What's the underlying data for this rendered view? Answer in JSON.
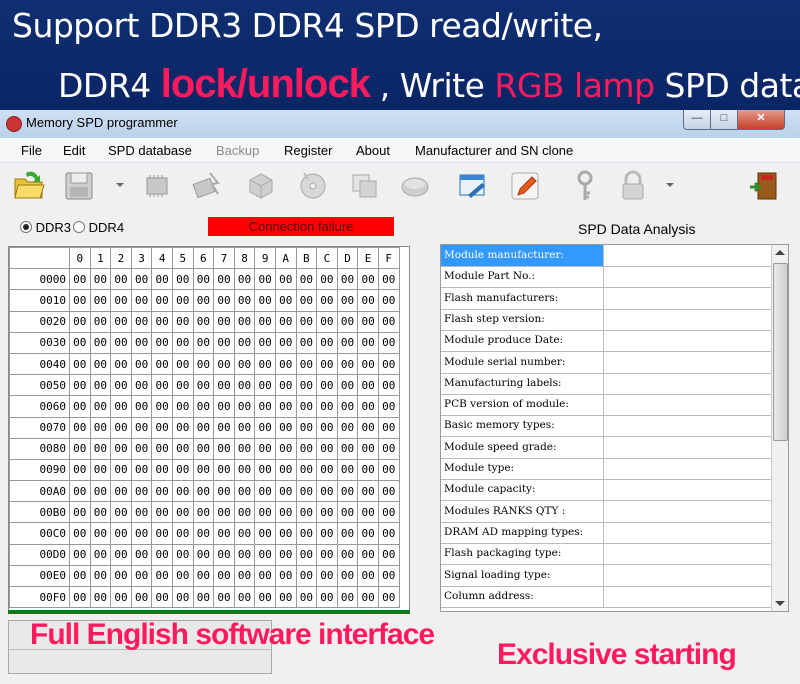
{
  "banner": {
    "line1": "Support DDR3 DDR4 SPD read/write,",
    "line2_prefix": "DDR4 ",
    "line2_highlight": "lock/unlock",
    "line2_mid": " , Write ",
    "line2_highlight2": "RGB lamp",
    "line2_suffix": " SPD data",
    "highlight_color": "#ff1a5e"
  },
  "window": {
    "title": "Memory SPD programmer",
    "min_glyph": "—",
    "max_glyph": "□",
    "close_glyph": "✕"
  },
  "menu": [
    "File",
    "Edit",
    "SPD database",
    "Backup",
    "Register",
    "About",
    "Manufacturer and SN clone"
  ],
  "menu_disabled": "Backup",
  "toolbar": {
    "icons": [
      "open-folder-icon",
      "save-icon",
      "chip-icon",
      "chip-flash-icon",
      "cube-icon",
      "disc-icon",
      "copy-icon",
      "oval-icon",
      "edit-window-icon",
      "pencil-icon",
      "key-icon",
      "padlock-icon",
      "exit-door-icon"
    ]
  },
  "radio": {
    "ddr3": "DDR3",
    "ddr4": "DDR4",
    "selected": "DDR3"
  },
  "status": {
    "connection": "Connection failure",
    "color": "#ff0000"
  },
  "analysis_title": "SPD Data Analysis",
  "hex": {
    "columns": [
      "0",
      "1",
      "2",
      "3",
      "4",
      "5",
      "6",
      "7",
      "8",
      "9",
      "A",
      "B",
      "C",
      "D",
      "E",
      "F"
    ],
    "rows": [
      "0000",
      "0010",
      "0020",
      "0030",
      "0040",
      "0050",
      "0060",
      "0070",
      "0080",
      "0090",
      "00A0",
      "00B0",
      "00C0",
      "00D0",
      "00E0",
      "00F0"
    ],
    "fill_value": "00"
  },
  "analysis": [
    "Module manufacturer:",
    "Module Part No.:",
    "Flash manufacturers:",
    "Flash step version:",
    "Module produce Date:",
    "Module serial number:",
    "Manufacturing labels:",
    "PCB version of module:",
    "Basic memory types:",
    "Module speed grade:",
    "Module type:",
    "Module capacity:",
    "Modules RANKS QTY :",
    "DRAM AD mapping types:",
    "Flash packaging type:",
    "Signal loading type:",
    "Column address:"
  ],
  "promo": {
    "left": "Full English software interface",
    "right": "Exclusive starting"
  }
}
